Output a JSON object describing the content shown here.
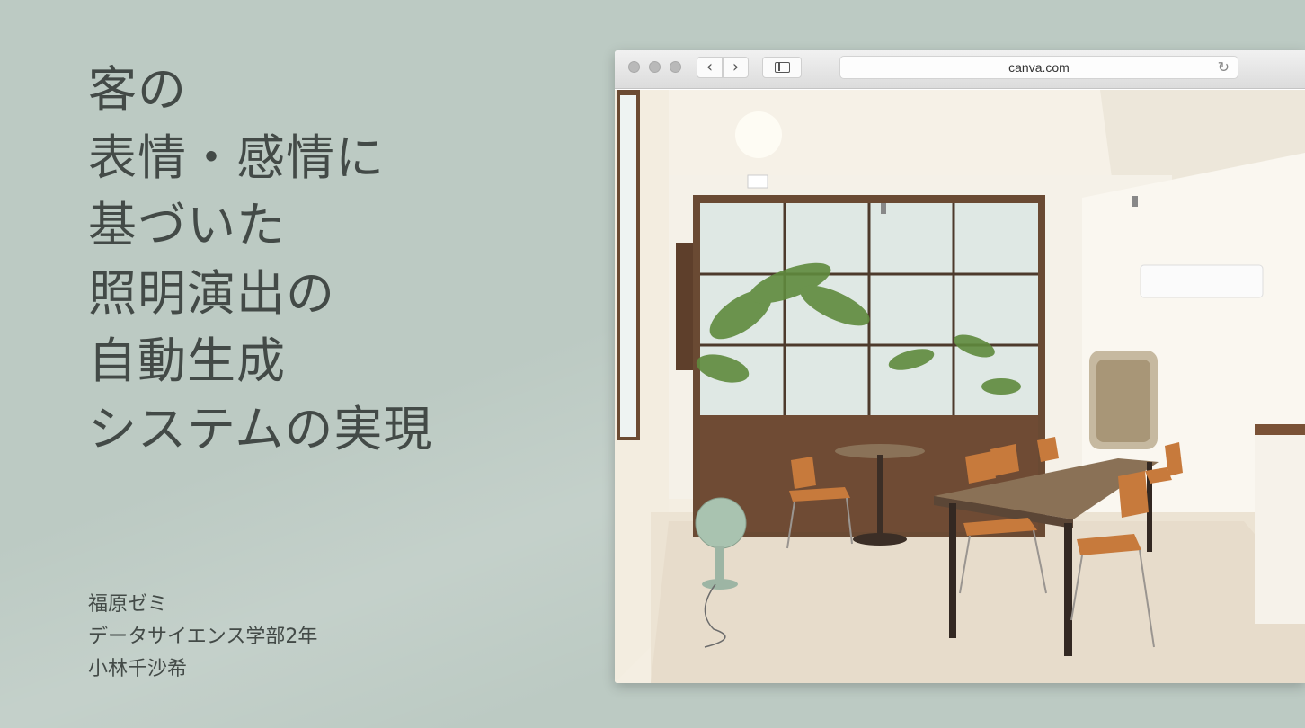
{
  "title_lines": [
    "客の",
    "表情・感情に",
    "基づいた",
    "照明演出の",
    "自動生成",
    "システムの実現"
  ],
  "subtitle_lines": [
    "福原ゼミ",
    "データサイエンス学部2年",
    "小林千沙希"
  ],
  "browser": {
    "url": "canva.com",
    "back_icon": "chevron-left-icon",
    "forward_icon": "chevron-right-icon",
    "sidebar_icon": "sidebar-icon",
    "reload_icon": "reload-icon",
    "back_glyph": "‹",
    "forward_glyph": "›",
    "reload_glyph": "↻"
  },
  "colors": {
    "background": "#bccac3",
    "text": "#434a47"
  }
}
